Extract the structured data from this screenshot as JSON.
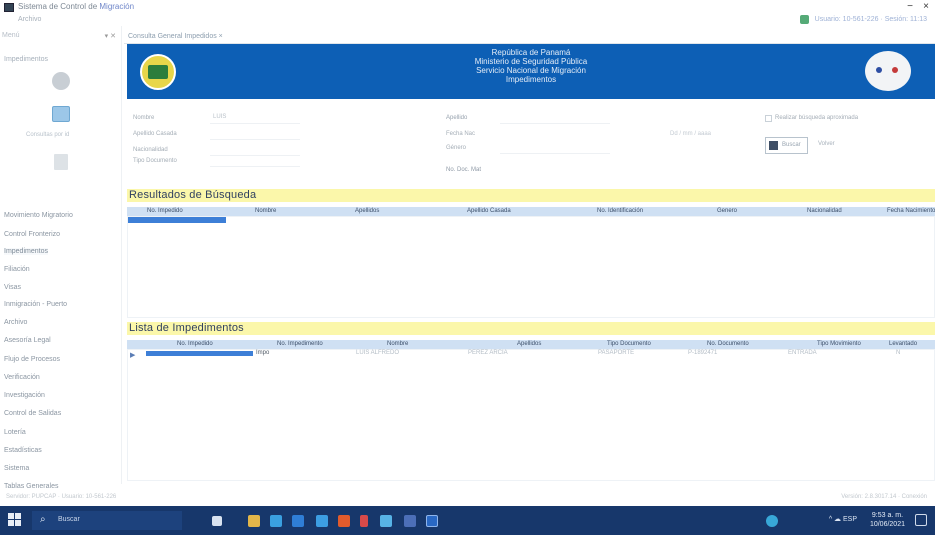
{
  "window": {
    "title_prefix": "Sistema de Control de ",
    "title_highlight": "Migración",
    "minimize": "−",
    "close": "×"
  },
  "menubar": {
    "menu": "Archivo",
    "user": "Usuario: 10-561-226 · Sesión: 11:13"
  },
  "sidebar": {
    "header": "Menú",
    "pin": "▾ ✕",
    "section_title": "Impedimentos",
    "monitor_label": "Consultas por id",
    "items": [
      {
        "label": "Movimiento Migratorio",
        "active": false
      },
      {
        "label": "Control Fronterizo",
        "active": false
      },
      {
        "label": "Impedimentos",
        "active": true
      },
      {
        "label": "Filiación",
        "active": false
      },
      {
        "label": "Visas",
        "active": false
      },
      {
        "label": "Inmigración - Puerto",
        "active": false
      },
      {
        "label": "Archivo",
        "active": false
      },
      {
        "label": "Asesoría Legal",
        "active": false
      },
      {
        "label": "Flujo de Procesos",
        "active": false
      },
      {
        "label": "Verificación",
        "active": false
      },
      {
        "label": "Investigación",
        "active": false
      },
      {
        "label": "Control de Salidas",
        "active": false
      },
      {
        "label": "Lotería",
        "active": false
      },
      {
        "label": "Estadísticas",
        "active": false
      },
      {
        "label": "Sistema",
        "active": false
      },
      {
        "label": "Tablas Generales",
        "active": false
      }
    ]
  },
  "tab": {
    "label": "Consulta General Impedidos ×"
  },
  "banner": {
    "line1": "República de Panamá",
    "line2": "Ministerio de Seguridad Pública",
    "line3": "Servicio Nacional de Migración",
    "line4": "Impedimentos"
  },
  "form": {
    "nombre_label": "Nombre",
    "nombre_value": "LUIS",
    "apellido_casada_label": "Apellido Casada",
    "nacionalidad_label": "Nacionalidad",
    "tipo_documento_label": "Tipo Documento",
    "apellido_label": "Apellido",
    "fecha_nac_label": "Fecha Nac",
    "genero_label": "Género",
    "no_doc_label": "No. Doc. Mat",
    "date_hint": "Dd / mm / aaaa",
    "checkbox_label": "Realizar búsqueda aproximada",
    "buscar_label": "Buscar",
    "limpiar_label": "Volver"
  },
  "results": {
    "title": "Resultados de Búsqueda",
    "columns": [
      "No. Impedido",
      "Nombre",
      "Apellidos",
      "Apellido Casada",
      "No. Identificación",
      "Genero",
      "Nacionalidad",
      "Fecha Nacimiento"
    ]
  },
  "impedimentos": {
    "title": "Lista de Impedimentos",
    "columns": [
      "No. Impedido",
      "No. Impedimento",
      "Nombre",
      "Apellidos",
      "Tipo Documento",
      "No. Documento",
      "Tipo Movimiento",
      "Levantado"
    ],
    "row": {
      "no_impedimento": "Impo",
      "nombre": "LUIS ALFREDO",
      "apellidos": "PEREZ ARCIA",
      "tipo_documento": "PASAPORTE",
      "no_documento": "P-1892471",
      "tipo_movimiento": "ENTRADA",
      "levantado": "N"
    }
  },
  "statusbar": {
    "left": "Servidor: PUPCAP · Usuario: 10-561-226",
    "right": "Versión: 2.8.3017.14 · Conexión"
  },
  "taskbar": {
    "search_placeholder": "Buscar",
    "tray": "^ ☁ ESP",
    "time": "9:53 a. m.",
    "date": "10/06/2021"
  }
}
